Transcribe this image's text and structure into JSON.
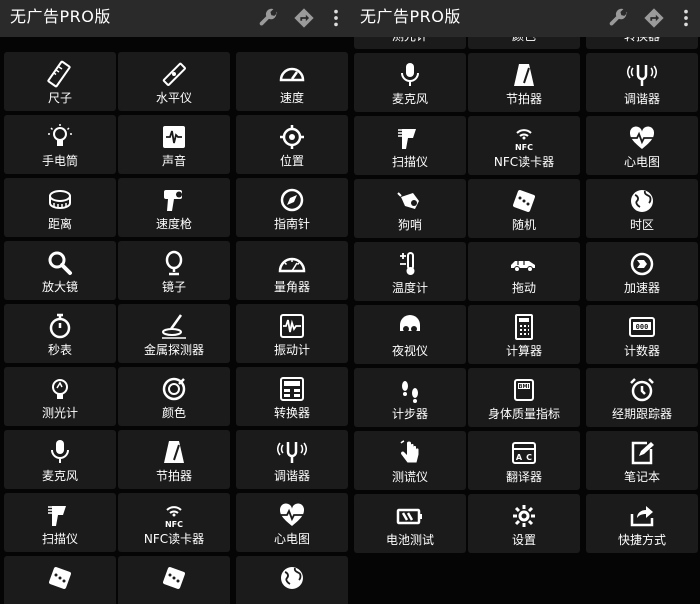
{
  "header": {
    "title": "无广告PRO版"
  },
  "left": {
    "tiles": [
      {
        "label": "尺子",
        "icon": "ruler-icon"
      },
      {
        "label": "水平仪",
        "icon": "level-icon"
      },
      {
        "label": "速度",
        "icon": "speedometer-icon"
      },
      {
        "label": "手电筒",
        "icon": "flashlight-icon"
      },
      {
        "label": "声音",
        "icon": "sound-meter-icon"
      },
      {
        "label": "位置",
        "icon": "location-icon"
      },
      {
        "label": "距离",
        "icon": "distance-icon"
      },
      {
        "label": "速度枪",
        "icon": "speed-gun-icon"
      },
      {
        "label": "指南针",
        "icon": "compass-icon"
      },
      {
        "label": "放大镜",
        "icon": "magnifier-icon"
      },
      {
        "label": "镜子",
        "icon": "mirror-icon"
      },
      {
        "label": "量角器",
        "icon": "protractor-icon"
      },
      {
        "label": "秒表",
        "icon": "stopwatch-icon"
      },
      {
        "label": "金属探测器",
        "icon": "metal-detector-icon"
      },
      {
        "label": "振动计",
        "icon": "vibrometer-icon"
      },
      {
        "label": "测光计",
        "icon": "light-meter-icon"
      },
      {
        "label": "颜色",
        "icon": "color-icon"
      },
      {
        "label": "转换器",
        "icon": "converter-icon"
      },
      {
        "label": "麦克风",
        "icon": "microphone-icon"
      },
      {
        "label": "节拍器",
        "icon": "metronome-icon"
      },
      {
        "label": "调谐器",
        "icon": "tuner-icon"
      },
      {
        "label": "扫描仪",
        "icon": "scanner-icon"
      },
      {
        "label": "NFC读卡器",
        "icon": "nfc-icon"
      },
      {
        "label": "心电图",
        "icon": "heart-rate-icon"
      },
      {
        "label": "",
        "icon": "dice-icon"
      },
      {
        "label": "",
        "icon": "dice-icon"
      },
      {
        "label": "",
        "icon": "globe-icon"
      }
    ]
  },
  "right": {
    "tiles": [
      {
        "label": "测光计",
        "icon": "light-meter-icon"
      },
      {
        "label": "颜色",
        "icon": "color-icon"
      },
      {
        "label": "转换器",
        "icon": "converter-icon"
      },
      {
        "label": "麦克风",
        "icon": "microphone-icon"
      },
      {
        "label": "节拍器",
        "icon": "metronome-icon"
      },
      {
        "label": "调谐器",
        "icon": "tuner-icon"
      },
      {
        "label": "扫描仪",
        "icon": "scanner-icon"
      },
      {
        "label": "NFC读卡器",
        "icon": "nfc-icon"
      },
      {
        "label": "心电图",
        "icon": "heart-rate-icon"
      },
      {
        "label": "狗哨",
        "icon": "dog-whistle-icon"
      },
      {
        "label": "随机",
        "icon": "dice-icon"
      },
      {
        "label": "时区",
        "icon": "globe-icon"
      },
      {
        "label": "温度计",
        "icon": "thermometer-icon"
      },
      {
        "label": "拖动",
        "icon": "car-icon"
      },
      {
        "label": "加速器",
        "icon": "accelerometer-icon"
      },
      {
        "label": "夜视仪",
        "icon": "night-vision-icon"
      },
      {
        "label": "计算器",
        "icon": "calculator-icon"
      },
      {
        "label": "计数器",
        "icon": "counter-icon"
      },
      {
        "label": "计步器",
        "icon": "footsteps-icon"
      },
      {
        "label": "身体质量指标",
        "icon": "bmi-scale-icon"
      },
      {
        "label": "经期跟踪器",
        "icon": "alarm-clock-icon"
      },
      {
        "label": "测谎仪",
        "icon": "lie-detector-icon"
      },
      {
        "label": "翻译器",
        "icon": "translator-icon"
      },
      {
        "label": "笔记本",
        "icon": "notebook-icon"
      },
      {
        "label": "电池测试",
        "icon": "battery-icon"
      },
      {
        "label": "设置",
        "icon": "settings-gear-icon"
      },
      {
        "label": "快捷方式",
        "icon": "share-shortcut-icon"
      }
    ]
  }
}
